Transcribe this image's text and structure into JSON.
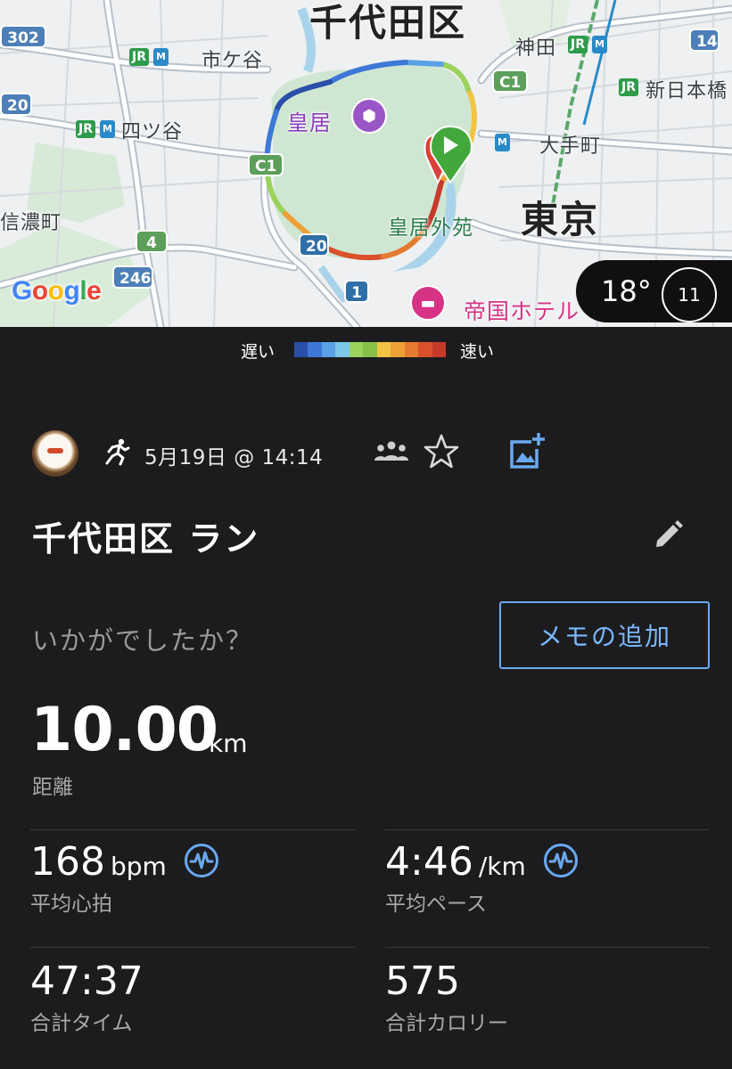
{
  "map": {
    "labels": {
      "ward": "千代田区",
      "palace": "皇居",
      "gaien": "皇居外苑",
      "tokyo": "東京",
      "ichigaya": "市ケ谷",
      "yotsuya": "四ツ谷",
      "shinanomachi": "信濃町",
      "kanda": "神田",
      "shin_nihonbashi": "新日本橋",
      "otemachi": "大手町",
      "hotel": "帝国ホテル"
    },
    "shields": {
      "r302": "302",
      "r20_left": "20",
      "c1_left": "C1",
      "c1_right": "C1",
      "r4": "4",
      "r246": "246",
      "r20_bottom": "20",
      "r1": "1",
      "r14": "14"
    },
    "rail": {
      "jr": "JR",
      "metro": "M"
    },
    "attribution": "Google",
    "weather": {
      "temp": "18°",
      "wind": "11"
    }
  },
  "legend": {
    "slow": "遅い",
    "fast": "速い",
    "colors": [
      "#2a4fa8",
      "#3d78d6",
      "#5aa0e6",
      "#7cc7e8",
      "#9bd25c",
      "#86c048",
      "#f2c443",
      "#eea038",
      "#e57a30",
      "#d9502a",
      "#c53a2a"
    ]
  },
  "activity": {
    "date": "5月19日 @ 14:14",
    "title": "千代田区 ラン",
    "prompt": "いかがでしたか？",
    "memo_button": "メモの追加",
    "distance": {
      "value": "10.00",
      "unit": "km",
      "label": "距離"
    },
    "avg_hr": {
      "value": "168",
      "unit": "bpm",
      "label": "平均心拍"
    },
    "avg_pace": {
      "value": "4:46",
      "unit": "/km",
      "label": "平均ペース"
    },
    "total_time": {
      "value": "47:37",
      "label": "合計タイム"
    },
    "calories": {
      "value": "575",
      "label": "合計カロリー"
    }
  },
  "icons": {
    "activity_type": "running-icon",
    "group": "group-icon",
    "favorite": "star-icon",
    "add_photo": "add-photo-icon",
    "edit": "pencil-icon",
    "hr_chart": "heart-rate-icon"
  }
}
